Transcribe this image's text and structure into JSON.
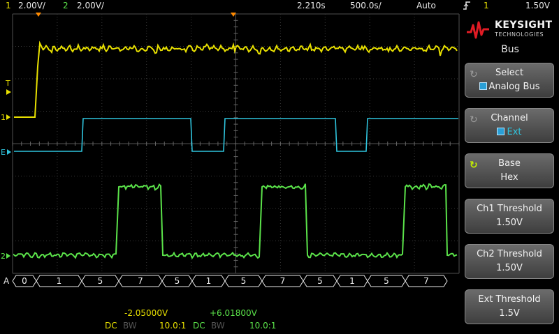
{
  "status_bar": {
    "ch1_number": "1",
    "ch1_scale": "2.00V/",
    "ch2_number": "2",
    "ch2_scale": "2.00V/",
    "time_delay": "2.210s",
    "time_scale": "500.0s/",
    "trigger_mode": "Auto",
    "trigger_slope_icon": "rising-edge-icon",
    "trigger_source": "1",
    "trigger_level": "1.50V"
  },
  "brand": {
    "name": "KEYSIGHT",
    "subtitle": "TECHNOLOGIES",
    "logo_icon": "keysight-wave-logo-icon"
  },
  "menu": {
    "title": "Bus",
    "softkeys": [
      {
        "label": "Select",
        "value": "Analog Bus",
        "value_icon": "blue-square-icon"
      },
      {
        "label": "Channel",
        "value": "Ext",
        "value_icon": "blue-square-icon"
      },
      {
        "label": "Base",
        "value": "Hex",
        "knob_active": true
      },
      {
        "label": "Ch1 Threshold",
        "value": "1.50V"
      },
      {
        "label": "Ch2 Threshold",
        "value": "1.50V"
      },
      {
        "label": "Ext Threshold",
        "value": "1.5V"
      }
    ]
  },
  "markers": {
    "trigger_level": "T",
    "ch1": "1",
    "ext": "E",
    "ch2": "2",
    "bus": "A"
  },
  "bus_decode": [
    "0",
    "1",
    "5",
    "7",
    "5",
    "1",
    "5",
    "7",
    "5",
    "1",
    "5",
    "7"
  ],
  "bottom_bar": {
    "ch1_offset": "-2.05000V",
    "ch2_offset": "+6.01800V",
    "ch1_coupling": "DC",
    "ch1_bw": "BW",
    "ch1_probe": "10.0:1",
    "ch2_coupling": "DC",
    "ch2_bw": "BW",
    "ch2_probe": "10.0:1"
  },
  "colors": {
    "ch1": "#e8e000",
    "ch2": "#5be34a",
    "ext": "#2fc4dd",
    "grid": "#3a3a3a",
    "trigger_marker": "#ff8a00"
  }
}
